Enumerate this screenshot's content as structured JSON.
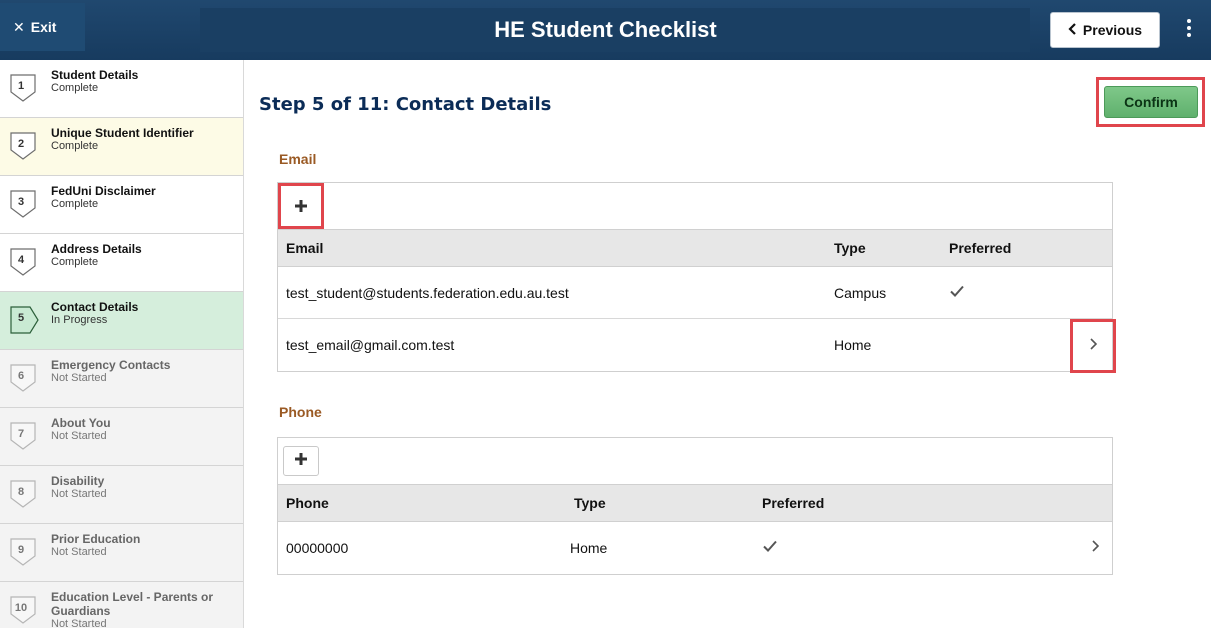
{
  "header": {
    "exit_label": "Exit",
    "title": "HE Student Checklist",
    "previous_label": "Previous"
  },
  "sidebar": {
    "steps": [
      {
        "num": "1",
        "title": "Student Details",
        "status": "Complete"
      },
      {
        "num": "2",
        "title": "Unique Student Identifier",
        "status": "Complete"
      },
      {
        "num": "3",
        "title": "FedUni Disclaimer",
        "status": "Complete"
      },
      {
        "num": "4",
        "title": "Address Details",
        "status": "Complete"
      },
      {
        "num": "5",
        "title": "Contact Details",
        "status": "In Progress"
      },
      {
        "num": "6",
        "title": "Emergency Contacts",
        "status": "Not Started"
      },
      {
        "num": "7",
        "title": "About You",
        "status": "Not Started"
      },
      {
        "num": "8",
        "title": "Disability",
        "status": "Not Started"
      },
      {
        "num": "9",
        "title": "Prior Education",
        "status": "Not Started"
      },
      {
        "num": "10",
        "title": "Education Level - Parents or Guardians",
        "status": "Not Started"
      }
    ]
  },
  "main": {
    "step_heading": "Step 5 of 11: Contact Details",
    "confirm_label": "Confirm",
    "email": {
      "section_label": "Email",
      "columns": [
        "Email",
        "Type",
        "Preferred"
      ],
      "rows": [
        {
          "email": "test_student@students.federation.edu.au.test",
          "type": "Campus",
          "preferred": true
        },
        {
          "email": "test_email@gmail.com.test",
          "type": "Home",
          "preferred": false
        }
      ]
    },
    "phone": {
      "section_label": "Phone",
      "columns": [
        "Phone",
        "Type",
        "Preferred"
      ],
      "rows": [
        {
          "phone": "00000000",
          "type": "Home",
          "preferred": true
        }
      ]
    }
  },
  "colors": {
    "header_bg": "#173b5f",
    "heading_text": "#0b2c57",
    "section_label": "#9a5a24",
    "confirm_green": "#5fb06d",
    "current_step_bg": "#d5eedc",
    "highlight_box": "#e0454c"
  }
}
